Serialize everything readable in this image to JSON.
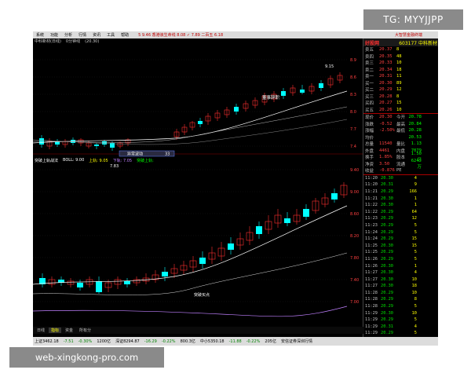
{
  "overlay": {
    "tg_badge": "TG: MYYJJPP",
    "watermark": "web-xingkong-pro.com"
  },
  "menubar": {
    "items": [
      "系统",
      "功能",
      "分析",
      "行情",
      "资讯",
      "工具",
      "帮助"
    ],
    "ticker": "5 9.46 香港浪生命线 8.08 ✓ 7.89 二百五 6.18",
    "title": "大智慧金融终端"
  },
  "chart_top": {
    "title_items": [
      "中科新材(日线)",
      "0分钟线",
      "(20.30)"
    ],
    "high_label": "9.15",
    "low_label": "7.83",
    "annotation_board": "董事辞职",
    "annotation_popup_label": "异常波动",
    "annotation_popup_value": "33",
    "price_ticks": [
      "8.9",
      "8.6",
      "8.3",
      "8.0",
      "7.7",
      "7.4"
    ]
  },
  "chart_bottom": {
    "title_items": [
      "突破上轨战法",
      "BOLL: 9.00",
      "上轨: 9.05",
      "下轨: 7.05",
      "突破上轨: "
    ],
    "annotation": "突破买点",
    "price_ticks": [
      "9.40",
      "9.00",
      "8.60",
      "8.20",
      "7.80",
      "7.40",
      "7.00"
    ]
  },
  "right_panel": {
    "logo": "好股网",
    "code": "603177 中科新材",
    "quotes": [
      {
        "lbl": "卖五",
        "p": "20.37",
        "q": "8"
      },
      {
        "lbl": "卖四",
        "p": "20.35",
        "q": "48"
      },
      {
        "lbl": "卖三",
        "p": "20.33",
        "q": "10"
      },
      {
        "lbl": "卖二",
        "p": "20.34",
        "q": "18"
      },
      {
        "lbl": "卖一",
        "p": "20.31",
        "q": "11"
      },
      {
        "lbl": "买一",
        "p": "20.30",
        "q": "89"
      },
      {
        "lbl": "买二",
        "p": "20.29",
        "q": "12"
      },
      {
        "lbl": "买三",
        "p": "20.28",
        "q": "8"
      },
      {
        "lbl": "买四",
        "p": "20.27",
        "q": "15"
      },
      {
        "lbl": "买五",
        "p": "20.26",
        "q": "10"
      }
    ],
    "stats": [
      {
        "lbl": "现价",
        "v1": "20.30",
        "v3": "今开",
        "v4": "20.78"
      },
      {
        "lbl": "涨跌",
        "v1": "-0.52",
        "v3": "最高",
        "v4": "20.84"
      },
      {
        "lbl": "涨幅",
        "v1": "-2.50%",
        "v3": "最低",
        "v4": "20.28"
      },
      {
        "lbl": "均价",
        "v1": "",
        "v3": "",
        "v4": "20.53"
      },
      {
        "lbl": "总量",
        "v1": "11540",
        "v3": "量比",
        "v4": "1.13"
      },
      {
        "lbl": "外盘",
        "v1": "4461",
        "v3": "内盘",
        "v4": "7079"
      },
      {
        "lbl": "换手",
        "v1": "1.85%",
        "v3": "股本",
        "v4": "1.50亿"
      },
      {
        "lbl": "净资",
        "v1": "3.50",
        "v3": "流通",
        "v4": "6247万"
      },
      {
        "lbl": "收益",
        "v1": "-0.876",
        "v3": "PE",
        "v4": ""
      }
    ],
    "ticks": [
      {
        "t": "11:20",
        "p": "20.30",
        "q": "4",
        "d": "3"
      },
      {
        "t": "11:20",
        "p": "20.31",
        "q": "9",
        "d": "3"
      },
      {
        "t": "11:21",
        "p": "20.29",
        "q": "166",
        "d": "3"
      },
      {
        "t": "11:21",
        "p": "20.30",
        "q": "1",
        "d": "3"
      },
      {
        "t": "11:22",
        "p": "20.30",
        "q": "1",
        "d": "3"
      },
      {
        "t": "11:22",
        "p": "20.29",
        "q": "64",
        "d": "3"
      },
      {
        "t": "11:23",
        "p": "20.29",
        "q": "12",
        "d": "3"
      },
      {
        "t": "11:23",
        "p": "20.29",
        "q": "5",
        "d": "3"
      },
      {
        "t": "11:24",
        "p": "20.29",
        "q": "5",
        "d": "3"
      },
      {
        "t": "11:24",
        "p": "20.29",
        "q": "15",
        "d": "3"
      },
      {
        "t": "11:25",
        "p": "20.30",
        "q": "15",
        "d": "3"
      },
      {
        "t": "11:25",
        "p": "20.29",
        "q": "5",
        "d": "3"
      },
      {
        "t": "11:26",
        "p": "20.29",
        "q": "5",
        "d": "3"
      },
      {
        "t": "11:26",
        "p": "20.30",
        "q": "1",
        "d": "3"
      },
      {
        "t": "11:27",
        "p": "20.30",
        "q": "4",
        "d": "3"
      },
      {
        "t": "11:27",
        "p": "20.30",
        "q": "10",
        "d": "3"
      },
      {
        "t": "11:27",
        "p": "20.30",
        "q": "18",
        "d": "3"
      },
      {
        "t": "11:28",
        "p": "20.29",
        "q": "10",
        "d": "3"
      },
      {
        "t": "11:28",
        "p": "20.29",
        "q": "8",
        "d": "3"
      },
      {
        "t": "11:28",
        "p": "20.29",
        "q": "5",
        "d": "3"
      },
      {
        "t": "11:29",
        "p": "20.30",
        "q": "10",
        "d": "3"
      },
      {
        "t": "11:29",
        "p": "20.29",
        "q": "5",
        "d": "3"
      },
      {
        "t": "11:29",
        "p": "20.31",
        "q": "4",
        "d": "3"
      },
      {
        "t": "11:29",
        "p": "20.29",
        "q": "5",
        "d": "3"
      },
      {
        "t": "11:30",
        "p": "20.30",
        "q": "4",
        "d": "3"
      }
    ]
  },
  "bottom_tabs": [
    "日线",
    "指标",
    "资金",
    "所有分"
  ],
  "statusbar": {
    "sh": "上证3462.18",
    "sh_chg": "-7.51",
    "sh_pct": "-0.30%",
    "sh_amt": "1200亿",
    "sz": "深证8294.87",
    "sz_chg": "-16.29",
    "sz_pct": "-0.22%",
    "sz_amt": "800.3亿",
    "cy": "中小5350.18",
    "cy_chg": "-11.88",
    "cy_pct": "-0.22%",
    "cy_amt": "205亿",
    "msg": "安信证券深圳行情"
  },
  "colors": {
    "up_candle": "#ff3030",
    "down_candle": "#00ffff",
    "ma_line": "#ffffff",
    "lower_band": "#c080ff"
  }
}
